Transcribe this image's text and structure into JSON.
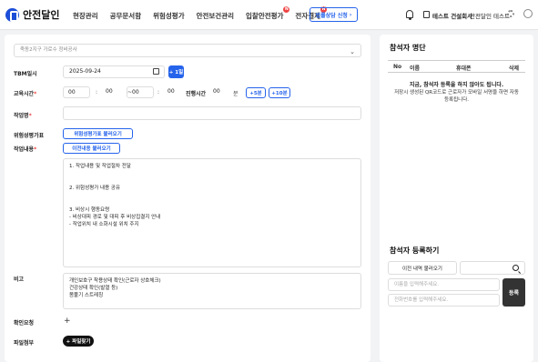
{
  "header": {
    "logo_text": "안전달인",
    "nav": [
      {
        "label": "현장관리",
        "badge": ""
      },
      {
        "label": "공무문서함",
        "badge": ""
      },
      {
        "label": "위험성평가",
        "badge": ""
      },
      {
        "label": "안전보건관리",
        "badge": ""
      },
      {
        "label": "입찰안전평가",
        "badge": "N"
      },
      {
        "label": "전자결제",
        "badge": "N"
      }
    ],
    "consult_button": "법률상담 신청",
    "company": "테스트 건설회사",
    "user": "안전달인 테스트",
    "icons": [
      "bell-icon",
      "building-icon",
      "gear-icon",
      "profile-icon"
    ]
  },
  "form": {
    "site_placeholder": "죽동2지구 가로수 정비공사",
    "tbm_label": "TBM일시",
    "tbm_date": "2025-09-24",
    "plus_day": "+ 1일",
    "edu_time_label": "교육시간",
    "start_hour": "00",
    "start_min": "00",
    "end_hour": "00",
    "end_min": "00",
    "duration_label": "진행시간",
    "duration_value": "00",
    "duration_unit": "분",
    "plus5": "+5분",
    "plus10": "+10분",
    "work_name_label": "작업명",
    "risk_label": "위험성평가표",
    "risk_button": "위험성평가표 불러오기",
    "work_content_label": "작업내용",
    "prev_button": "이전내용 불러오기",
    "work_content_lines": [
      "1. 작업내용 및 작업절차 전달",
      "",
      "",
      "2. 위험성평가 내용 공유",
      "",
      "",
      "3. 비상시 행동요령",
      "  - 비상대피 경로 및 대피 후 비상집결지 안내",
      "  - 작업위치 내 소화시설 위치 주지"
    ],
    "note_label": "비고",
    "note_lines": [
      "개인보호구 착용상태 확인(근로자 상호체크)",
      "건강상태 확인(발열 등)",
      "몸풀기 스트레칭"
    ],
    "confirm_label": "확인요청",
    "confirm_plus": "+",
    "attach_label": "파일첨부",
    "attach_button": "+ 파일찾기"
  },
  "attendees": {
    "title": "참석자 명단",
    "columns": [
      "No",
      "이름",
      "휴대폰",
      "삭제"
    ],
    "empty_title": "지금, 참석자 등록을 하지 않아도 됩니다.",
    "empty_desc_lines": [
      "저장시 생성된 QR코드로 근로자가 모바일 서명을 하면 자동",
      "등록됩니다."
    ]
  },
  "register": {
    "title": "참석자 등록하기",
    "prev_list_button": "이전 내역 불러오기",
    "name_placeholder": "이름을 입력해주세요.",
    "phone_placeholder": "전화번호를 입력해주세요.",
    "register_button": "등록"
  }
}
